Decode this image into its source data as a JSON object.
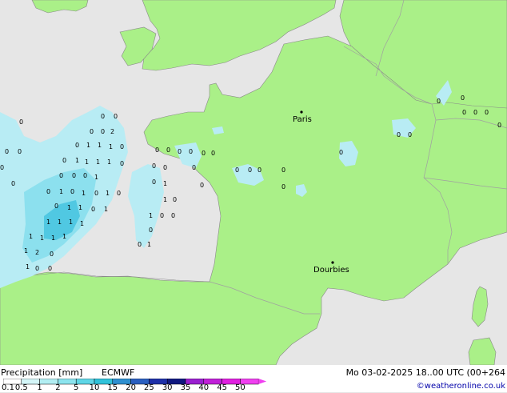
{
  "legend": {
    "title": "Precipitation [mm]",
    "model": "ECMWF",
    "valid_time": "Mo 03-02-2025 18..00 UTC (00+264",
    "credit": "©weatheronline.co.uk",
    "ticks": [
      "0.1",
      "0.5",
      "1",
      "2",
      "5",
      "10",
      "15",
      "20",
      "25",
      "30",
      "35",
      "40",
      "45",
      "50"
    ],
    "colors": [
      "#ffffff",
      "#d4f6f8",
      "#b2eef2",
      "#8ce4ee",
      "#5fd6e6",
      "#30c2da",
      "#2e8fd0",
      "#2a5fc0",
      "#1e30a8",
      "#101880",
      "#9a20d0",
      "#c020d8",
      "#e020e0",
      "#f040f0"
    ]
  },
  "cities": [
    {
      "name": "Paris"
    },
    {
      "name": "Dourbies"
    }
  ],
  "colors": {
    "land": "#aaf088",
    "sea": "#e6e6e6",
    "outside": "#dcdcdc",
    "border": "#a0a0a0",
    "coast": "#888888",
    "precip_light": "#b8ecf4",
    "precip_mid": "#8ce0ee",
    "precip_heavy": "#50c8e2"
  },
  "point_values": [
    "0",
    "1",
    "2"
  ]
}
